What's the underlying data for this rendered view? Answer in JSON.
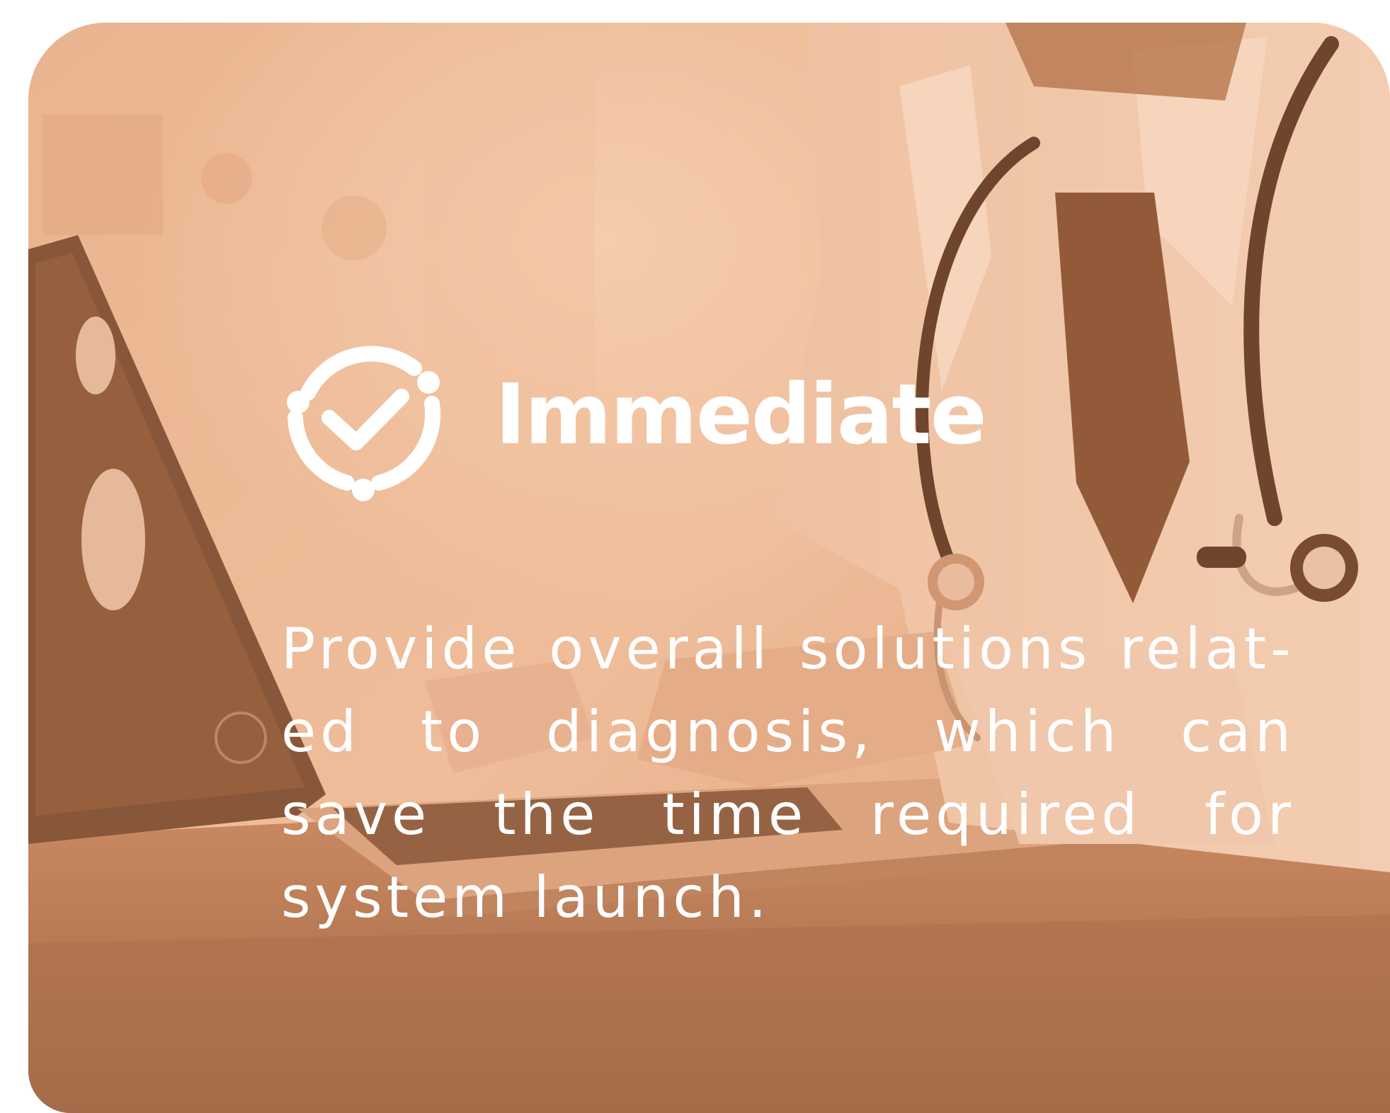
{
  "card": {
    "title": "Immediate",
    "icon": "check-cycle-icon",
    "lines": [
      "Provide overall solutions relat-",
      "ed to diagnosis, which can save",
      "the time required for system",
      "launch."
    ]
  },
  "colors": {
    "overlay": "#e9b08c",
    "shadow": "#7a4a2c",
    "text": "#ffffff"
  }
}
